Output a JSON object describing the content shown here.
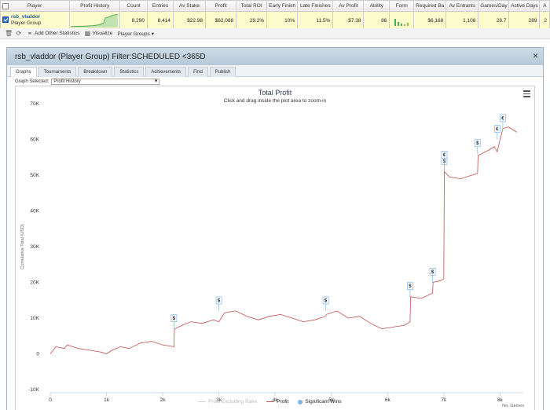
{
  "table": {
    "headers": [
      "Player",
      "Profit History",
      "Count",
      "Entries",
      "Av Stake",
      "Profit",
      "Total ROI",
      "Early Finish",
      "Late Finishes",
      "Av Profit",
      "Ability",
      "Form",
      "Required Ba",
      "Av Entrants",
      "Games/Day",
      "Active Days",
      "A"
    ],
    "row": {
      "name": "rsb_vladdor",
      "type": "Player Group",
      "values": [
        "8,290",
        "8,414",
        "$22.98",
        "$62,088",
        "29.2%",
        "10%",
        "11.5%",
        "$7.38",
        "86",
        "",
        "$6,168",
        "1,108",
        "28.7",
        "289",
        "2"
      ]
    }
  },
  "toolbar": {
    "add_stats": "Add Other Statistics",
    "visualize": "Visualize",
    "player_groups": "Player Groups ▾"
  },
  "panel": {
    "title": "rsb_vladdor (Player Group) Filter:SCHEDULED <365D",
    "tabs": [
      "Graphs",
      "Tournaments",
      "Breakdown",
      "Statistics",
      "Achievements",
      "Find",
      "Publish"
    ],
    "graph_selected_label": "Graph Selected:",
    "graph_selected_value": "Profit History"
  },
  "chart_data": {
    "type": "line",
    "title": "Total Profit",
    "subtitle": "Click and drag inside the plot area to zoom-in",
    "xlabel": "No. Games",
    "ylabel": "Cumulative Total (USD)",
    "xlim": [
      0,
      8400
    ],
    "ylim": [
      -10000,
      70000
    ],
    "x_ticks": [
      "0",
      "1k",
      "2k",
      "3k",
      "4k",
      "5k",
      "6k",
      "7k",
      "8k"
    ],
    "y_ticks": [
      "-10K",
      "0",
      "10K",
      "20K",
      "30K",
      "40K",
      "50K",
      "60K",
      "70K"
    ],
    "series": [
      {
        "name": "Profit",
        "color": "#c0504d",
        "x": [
          0,
          100,
          250,
          300,
          500,
          700,
          900,
          1000,
          1100,
          1250,
          1400,
          1600,
          1800,
          2000,
          2200,
          2210,
          2350,
          2500,
          2700,
          2900,
          3000,
          3100,
          3300,
          3500,
          3700,
          3900,
          4100,
          4300,
          4500,
          4700,
          4900,
          4910,
          5100,
          5300,
          5500,
          5700,
          5900,
          6100,
          6300,
          6400,
          6410,
          6600,
          6800,
          6810,
          6950,
          7000,
          7010,
          7100,
          7300,
          7500,
          7600,
          7610,
          7800,
          7900,
          7950,
          8000,
          8050,
          8150,
          8300
        ],
        "y": [
          0,
          2000,
          1500,
          2500,
          1500,
          1000,
          500,
          0,
          1000,
          2000,
          1500,
          3000,
          3500,
          2500,
          2000,
          7000,
          8000,
          9000,
          8500,
          9500,
          9000,
          11500,
          12000,
          10500,
          9500,
          10500,
          11000,
          10000,
          9000,
          9500,
          10500,
          11000,
          12000,
          10000,
          10500,
          8500,
          7000,
          7500,
          8000,
          9000,
          16000,
          15500,
          17000,
          20000,
          20500,
          21000,
          51000,
          49500,
          49000,
          50000,
          50500,
          55500,
          57000,
          58000,
          56500,
          60000,
          63000,
          63500,
          62000
        ]
      },
      {
        "name": "Profit Excluding Rake",
        "color": "#d0d0d0",
        "x": [],
        "y": []
      }
    ],
    "markers": [
      {
        "x": 2200,
        "y": 7000,
        "label": "$"
      },
      {
        "x": 3000,
        "y": 12000,
        "label": "$"
      },
      {
        "x": 4900,
        "y": 12000,
        "label": "$"
      },
      {
        "x": 6400,
        "y": 16000,
        "label": "$"
      },
      {
        "x": 6800,
        "y": 20000,
        "label": "$"
      },
      {
        "x": 7010,
        "y": 51000,
        "label": "$"
      },
      {
        "x": 7010,
        "y": 51000,
        "label": "€"
      },
      {
        "x": 7600,
        "y": 56000,
        "label": "$"
      },
      {
        "x": 7950,
        "y": 60000,
        "label": "€"
      },
      {
        "x": 8050,
        "y": 63000,
        "label": "€"
      }
    ],
    "legend": [
      {
        "label": "Profit Excluding Rake",
        "color": "#d0d0d0",
        "kind": "line"
      },
      {
        "label": "Profit",
        "color": "#c0504d",
        "kind": "line"
      },
      {
        "label": "Significant Wins",
        "color": "#7cb5ec",
        "kind": "dot"
      }
    ],
    "legend_position": "bottom",
    "grid": false
  }
}
